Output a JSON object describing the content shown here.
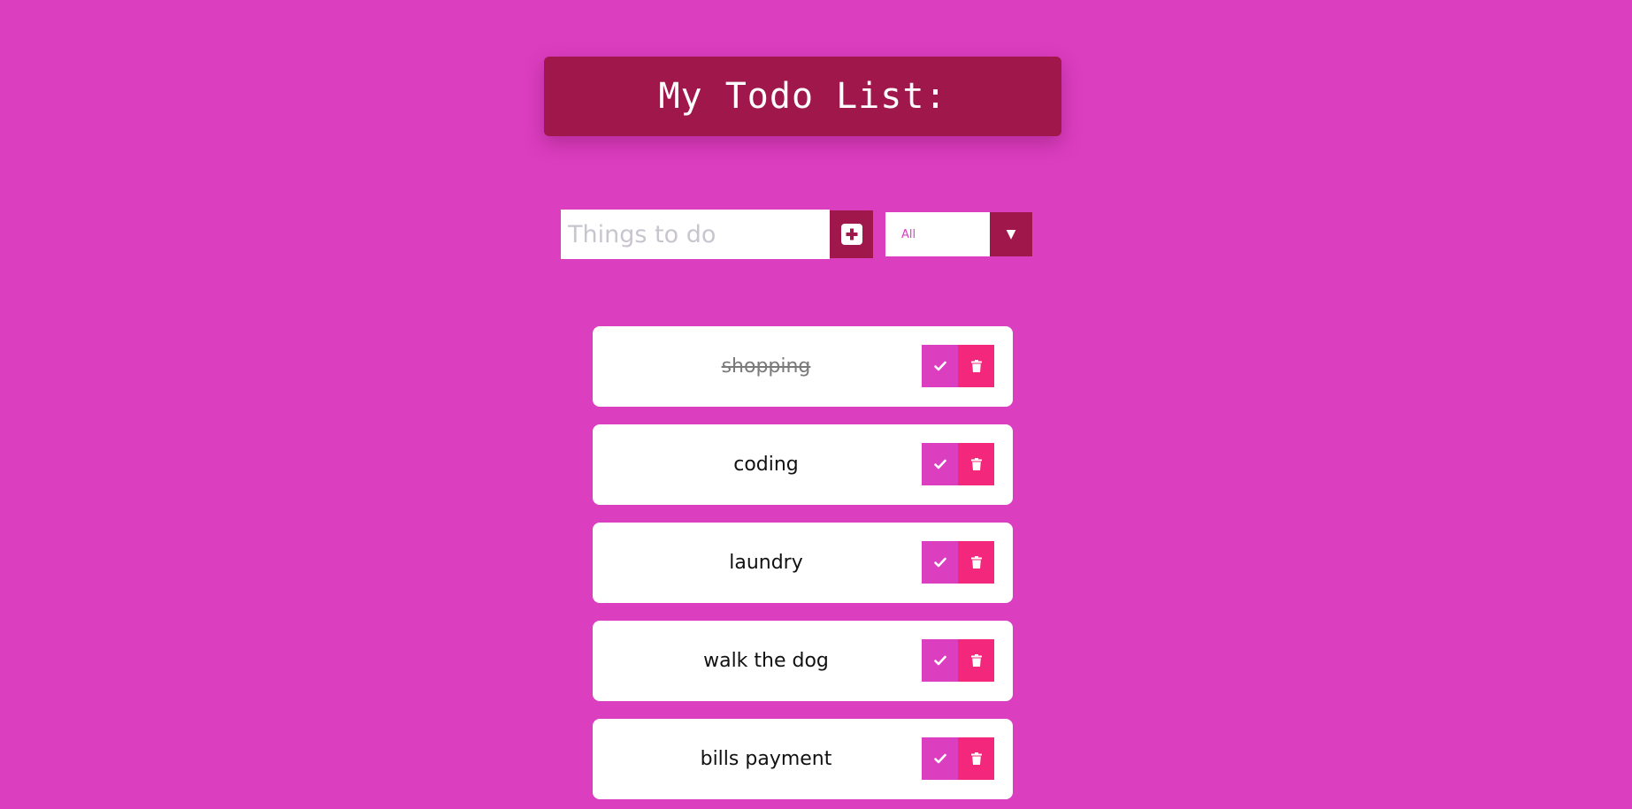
{
  "header": {
    "title": "My Todo List:"
  },
  "form": {
    "input_placeholder": "Things to do",
    "input_value": "",
    "add_icon": "plus-square-icon"
  },
  "filter": {
    "selected": "All",
    "arrow_icon": "triangle-down-icon"
  },
  "todos": [
    {
      "text": "shopping",
      "completed": true
    },
    {
      "text": "coding",
      "completed": false
    },
    {
      "text": "laundry",
      "completed": false
    },
    {
      "text": "walk the dog",
      "completed": false
    },
    {
      "text": "bills payment",
      "completed": false
    }
  ],
  "icons": {
    "complete": "check-icon",
    "delete": "trash-icon"
  },
  "colors": {
    "background": "#db3ebf",
    "header": "#a0184b",
    "complete_button": "#db3ebf",
    "trash_button": "#f3287d"
  }
}
